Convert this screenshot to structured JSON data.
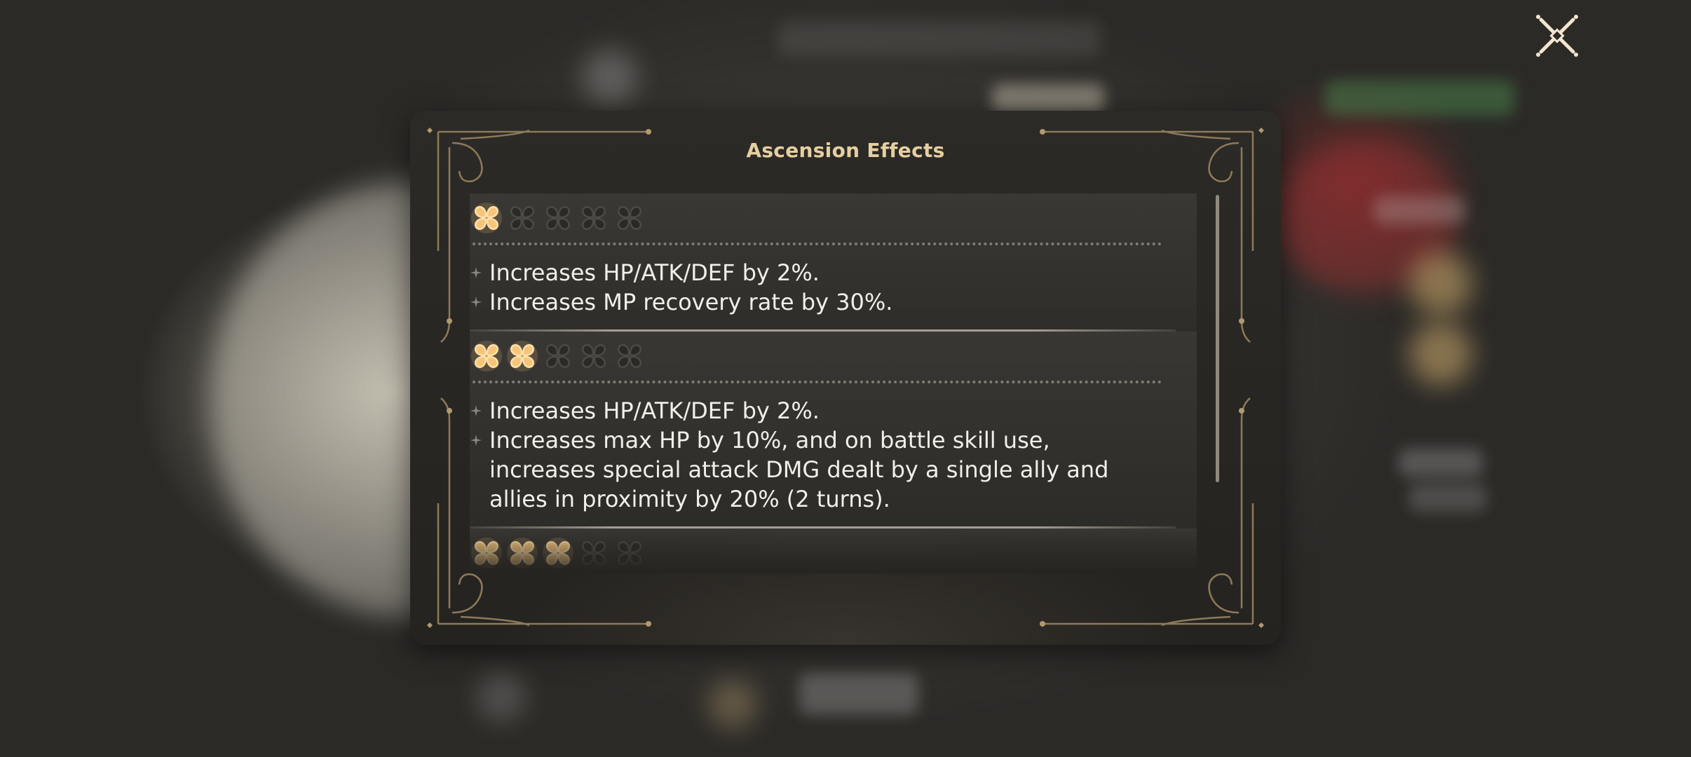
{
  "dialog": {
    "title": "Ascension Effects",
    "close_icon": "close-x-icon",
    "sections": [
      {
        "stars_filled": 1,
        "stars_total": 5,
        "effects": [
          "Increases HP/ATK/DEF by 2%.",
          "Increases MP recovery rate by 30%."
        ]
      },
      {
        "stars_filled": 2,
        "stars_total": 5,
        "effects": [
          "Increases HP/ATK/DEF by 2%.",
          "Increases max HP by 10%, and on battle skill use, increases special attack DMG dealt by a single ally and allies in proximity by 20% (2 turns)."
        ]
      },
      {
        "stars_filled": 3,
        "stars_total": 5,
        "effects": []
      }
    ]
  },
  "colors": {
    "title": "#e6cfa0",
    "star_filled": "#f6c47a",
    "star_empty": "#4b4a47",
    "text": "#f2efe8"
  },
  "icons": {
    "star": "flower-star-icon",
    "bullet": "sparkle-bullet-icon"
  }
}
